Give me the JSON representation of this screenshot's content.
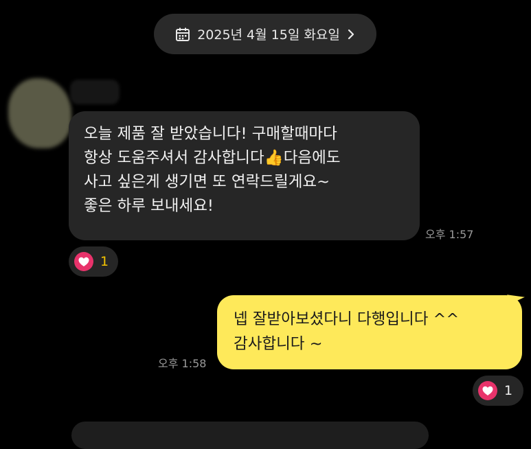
{
  "date_separator": {
    "label": "2025년 4월 15일 화요일",
    "icon": "calendar-icon",
    "chevron_icon": "chevron-right-icon"
  },
  "messages": [
    {
      "direction": "incoming",
      "lines": [
        "오늘 제품 잘 받았습니다! 구매할때마다",
        "항상 도움주셔서 감사합니다👍다음에도",
        "사고 싶은게 생기면 또 연락드릴게요~",
        "좋은 하루 보내세요!"
      ],
      "time": "오후 1:57",
      "reaction": {
        "icon": "heart-icon",
        "count": "1"
      }
    },
    {
      "direction": "outgoing",
      "lines": [
        "넵 잘받아보셨다니 다행입니다 ^^",
        "감사합니다 ~"
      ],
      "time": "오후 1:58",
      "reaction": {
        "icon": "heart-icon",
        "count": "1"
      }
    }
  ],
  "colors": {
    "background": "#000000",
    "incoming_bubble": "#262626",
    "outgoing_bubble": "#fee95a",
    "heart_badge": "#e8336b",
    "date_pill": "#2a2a2a",
    "timestamp": "#9a9a9a"
  }
}
